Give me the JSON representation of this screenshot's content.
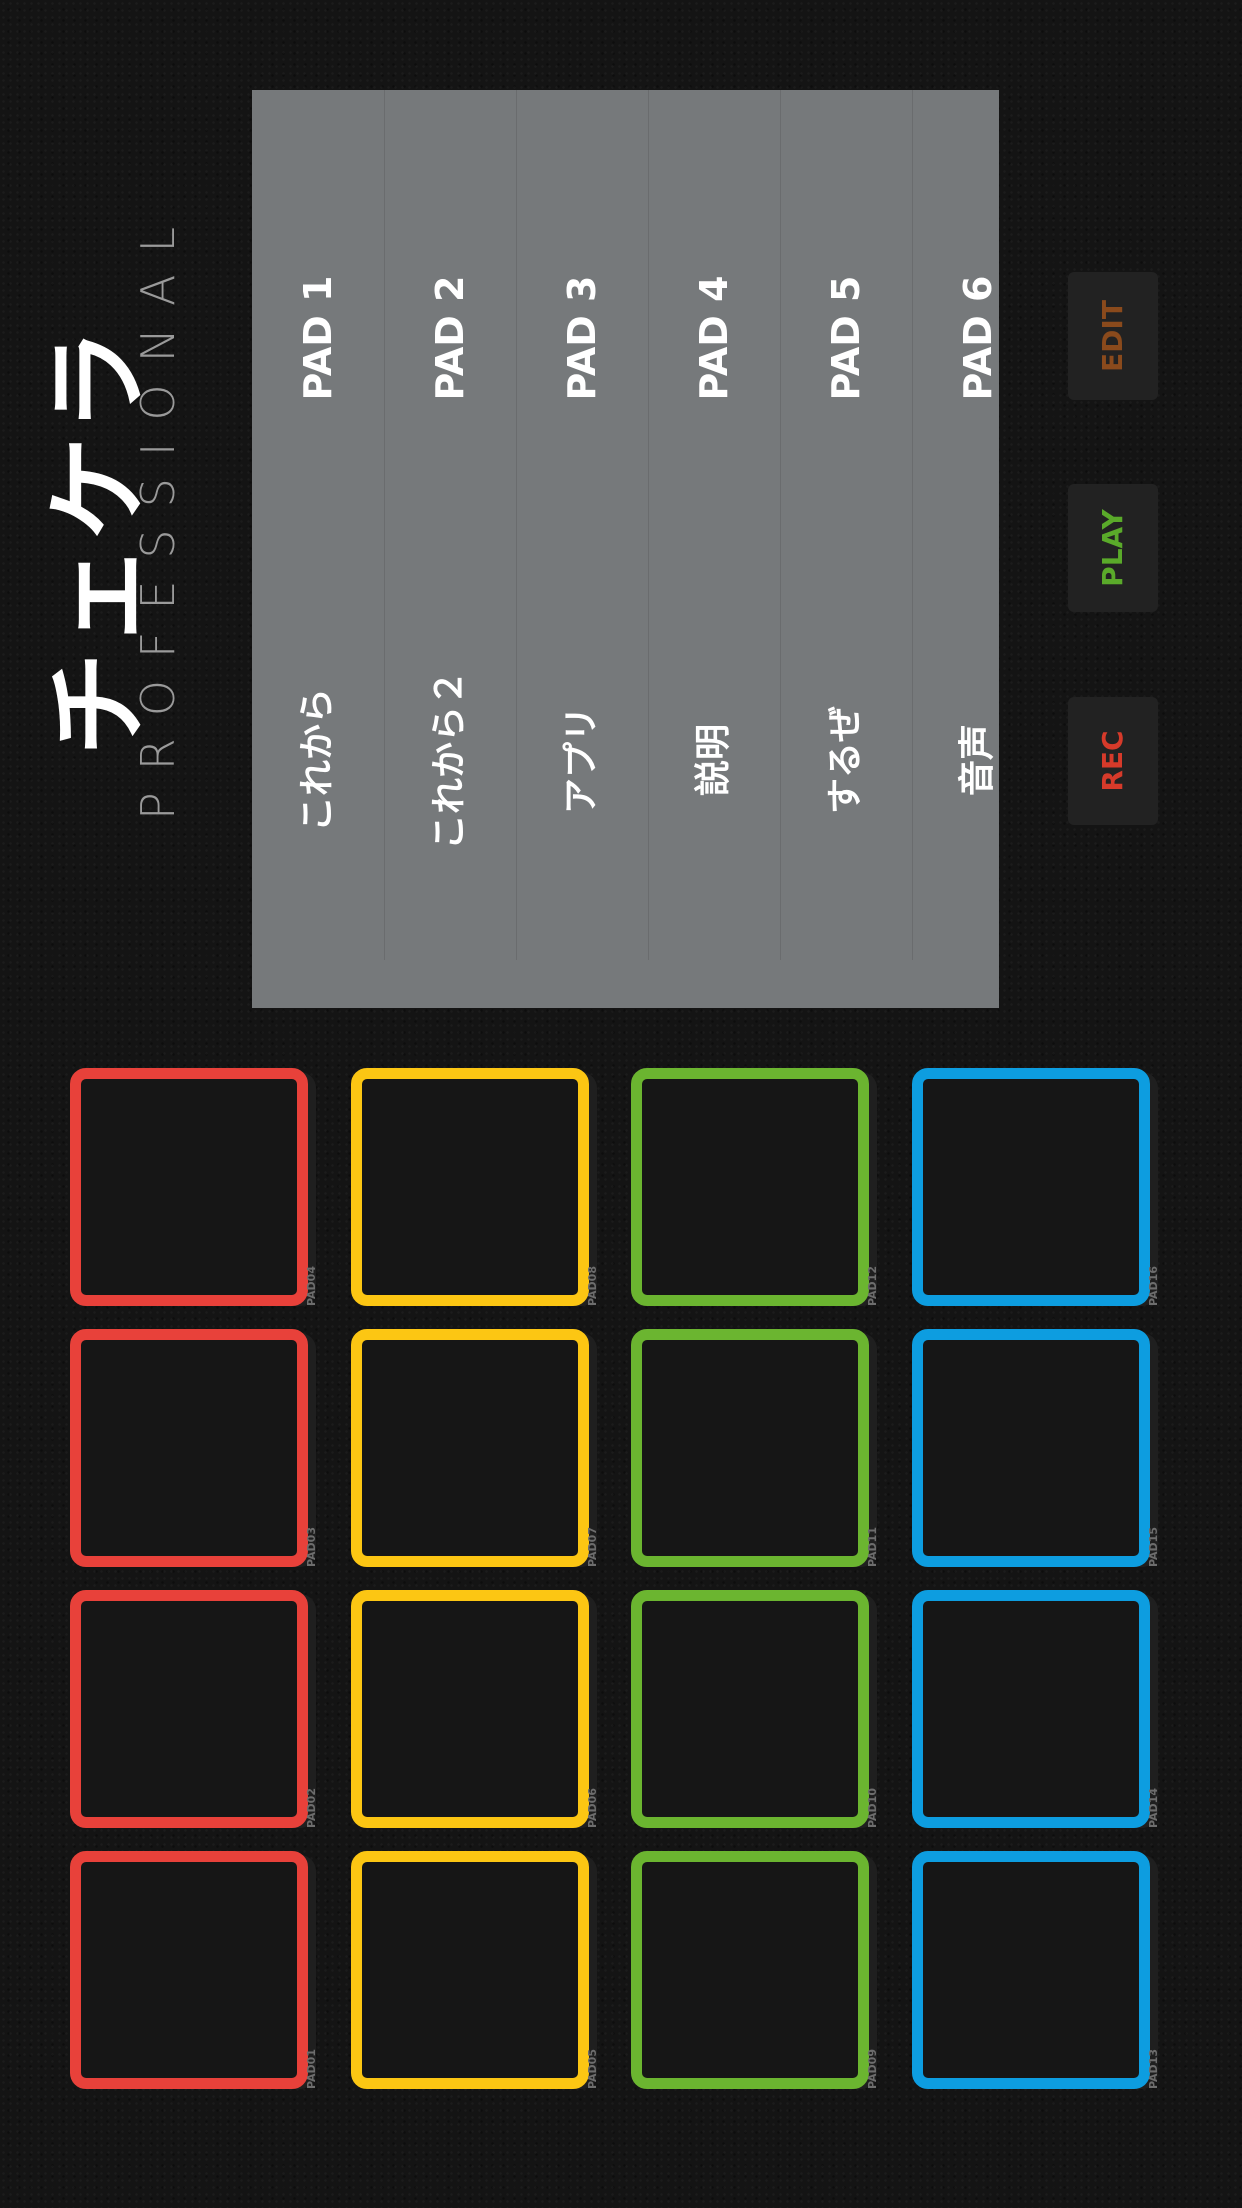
{
  "logo": {
    "main": "チェケラ",
    "sub": "PROFESSIONAL"
  },
  "pad_list": [
    {
      "pad": "PAD 1",
      "name": "これから"
    },
    {
      "pad": "PAD 2",
      "name": "これから２"
    },
    {
      "pad": "PAD 3",
      "name": "アプリ"
    },
    {
      "pad": "PAD 4",
      "name": "説明"
    },
    {
      "pad": "PAD 5",
      "name": "するぜ"
    },
    {
      "pad": "PAD 6",
      "name": "音声"
    }
  ],
  "controls": {
    "edit": "EDIT",
    "play": "PLAY",
    "rec": "REC"
  },
  "colors": {
    "panel": "#76797b",
    "edit": "#8a4a1c",
    "play": "#5aaa2a",
    "rec": "#d63a2a",
    "red": "#e8413a",
    "yellow": "#fcc613",
    "green": "#6bb530",
    "blue": "#0d9de0"
  },
  "pads": {
    "col1": [
      "PAD04",
      "PAD03",
      "PAD02",
      "PAD01"
    ],
    "col2": [
      "PAD08",
      "PAD07",
      "PAD06",
      "PAD05"
    ],
    "col3": [
      "PAD12",
      "PAD11",
      "PAD10",
      "PAD09"
    ],
    "col4": [
      "PAD16",
      "PAD15",
      "PAD14",
      "PAD13"
    ]
  }
}
